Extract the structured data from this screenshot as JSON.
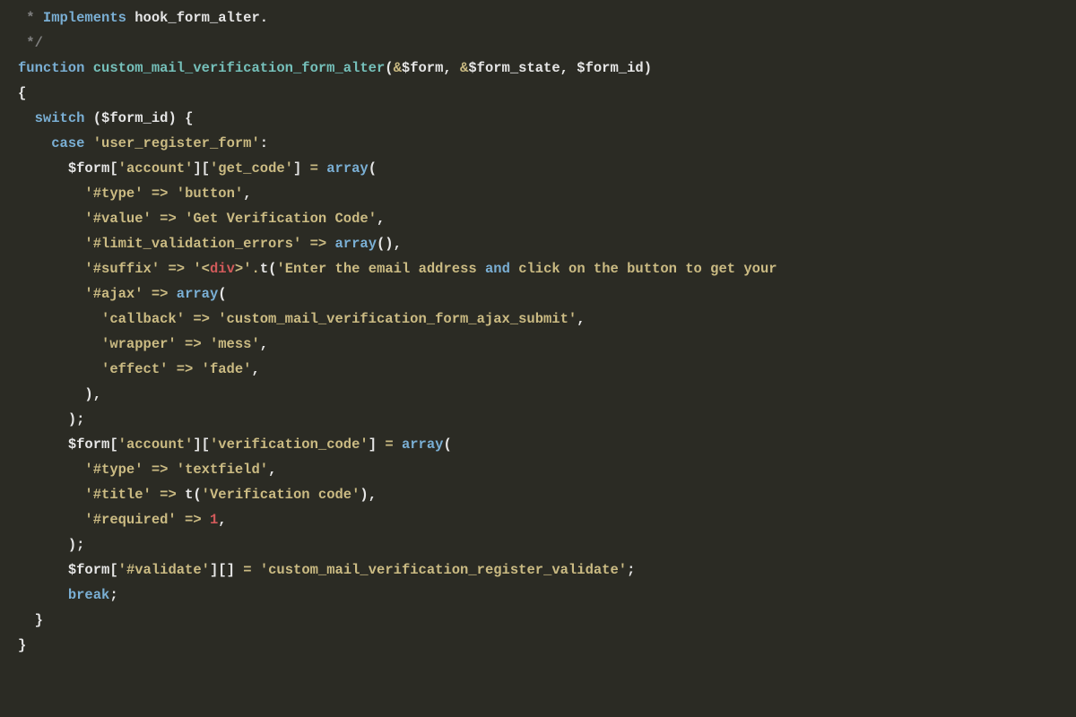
{
  "code": {
    "l1": {
      "star": " * ",
      "doctag": "Implements",
      "rest": " hook_form_alter."
    },
    "l2": {
      "end": " */"
    },
    "l3": {
      "kw": "function",
      "name": " custom_mail_verification_form_alter",
      "open": "(",
      "amp1": "&",
      "p1": "$form",
      "c1": ", ",
      "amp2": "&",
      "p2": "$form_state",
      "c2": ", ",
      "p3": "$form_id",
      "close": ")"
    },
    "l4": {
      "brace": "{"
    },
    "l5": {
      "indent": "  ",
      "kw": "switch",
      "sp": " ",
      "open": "(",
      "var": "$form_id",
      "close": ")",
      "brace": " {"
    },
    "l6": {
      "indent": "    ",
      "kw": "case",
      "sp": " ",
      "str": "'user_register_form'",
      "colon": ":"
    },
    "l7": {
      "indent": "      ",
      "var": "$form",
      "b1": "[",
      "k1": "'account'",
      "b2": "][",
      "k2": "'get_code'",
      "b3": "] ",
      "eq": "=",
      "sp": " ",
      "fn": "array",
      "open": "("
    },
    "l8": {
      "indent": "        ",
      "key": "'#type'",
      "arrow": " => ",
      "val": "'button'",
      "comma": ","
    },
    "l9": {
      "indent": "        ",
      "key": "'#value'",
      "arrow": " => ",
      "val": "'Get Verification Code'",
      "comma": ","
    },
    "l10": {
      "indent": "        ",
      "key": "'#limit_validation_errors'",
      "arrow": " => ",
      "fn": "array",
      "paren": "()",
      "comma": ","
    },
    "l11": {
      "indent": "        ",
      "key": "'#suffix'",
      "arrow": " => ",
      "q1": "'",
      "lt": "<",
      "tag": "div",
      "gt": ">",
      "q2": "'",
      "dot": ".",
      "tfn": "t(",
      "q3": "'",
      "msg": "Enter the email address ",
      "andkw": "and",
      "msg2": " click on the button to get your"
    },
    "l12": {
      "indent": "        ",
      "key": "'#ajax'",
      "arrow": " => ",
      "fn": "array",
      "open": "("
    },
    "l13": {
      "indent": "          ",
      "key": "'callback'",
      "arrow": " => ",
      "val": "'custom_mail_verification_form_ajax_submit'",
      "comma": ","
    },
    "l14": {
      "indent": "          ",
      "key": "'wrapper'",
      "arrow": " => ",
      "val": "'mess'",
      "comma": ","
    },
    "l15": {
      "indent": "          ",
      "key": "'effect'",
      "arrow": " => ",
      "val": "'fade'",
      "comma": ","
    },
    "l16": {
      "indent": "        ",
      "close": ")",
      "comma": ","
    },
    "l17": {
      "indent": "      ",
      "close": ")",
      "semi": ";"
    },
    "l18": {
      "indent": "      ",
      "var": "$form",
      "b1": "[",
      "k1": "'account'",
      "b2": "][",
      "k2": "'verification_code'",
      "b3": "] ",
      "eq": "=",
      "sp": " ",
      "fn": "array",
      "open": "("
    },
    "l19": {
      "indent": "        ",
      "key": "'#type'",
      "arrow": " => ",
      "val": "'textfield'",
      "comma": ","
    },
    "l20": {
      "indent": "        ",
      "key": "'#title'",
      "arrow": " => ",
      "tfn": "t(",
      "val": "'Verification code'",
      "close": ")",
      "comma": ","
    },
    "l21": {
      "indent": "        ",
      "key": "'#required'",
      "arrow": " => ",
      "num": "1",
      "comma": ","
    },
    "l22": {
      "indent": "      ",
      "close": ")",
      "semi": ";"
    },
    "l23": {
      "indent": "      ",
      "var": "$form",
      "b1": "[",
      "k1": "'#validate'",
      "b2": "][] ",
      "eq": "=",
      "sp": " ",
      "val": "'custom_mail_verification_register_validate'",
      "semi": ";"
    },
    "l24": {
      "indent": "      ",
      "kw": "break",
      "semi": ";"
    },
    "l25": {
      "indent": "  ",
      "brace": "}"
    },
    "l26": {
      "brace": "}"
    }
  }
}
